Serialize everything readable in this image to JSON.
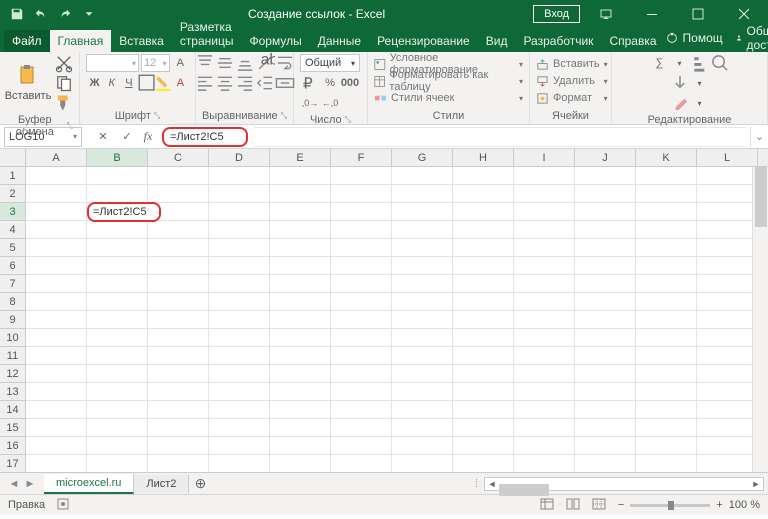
{
  "title": "Создание ссылок  -  Excel",
  "login": "Вход",
  "tabs": {
    "file": "Файл",
    "home": "Главная",
    "insert": "Вставка",
    "layout": "Разметка страницы",
    "formulas": "Формулы",
    "data": "Данные",
    "review": "Рецензирование",
    "view": "Вид",
    "developer": "Разработчик",
    "help": "Справка",
    "tellme": "Помощ",
    "share": "Общий доступ"
  },
  "ribbon": {
    "clipboard": {
      "label": "Буфер обмена",
      "paste": "Вставить"
    },
    "font": {
      "label": "Шрифт",
      "size": "12"
    },
    "align": {
      "label": "Выравнивание"
    },
    "number": {
      "label": "Число",
      "format": "Общий"
    },
    "styles": {
      "label": "Стили",
      "cond": "Условное форматирование",
      "table": "Форматировать как таблицу",
      "cell": "Стили ячеек"
    },
    "cells": {
      "label": "Ячейки",
      "insert": "Вставить",
      "delete": "Удалить",
      "format": "Формат"
    },
    "editing": {
      "label": "Редактирование"
    }
  },
  "namebox": "LOG10",
  "formula": "=Лист2!C5",
  "cell": {
    "value": "=Лист2!C5",
    "ref": "B3"
  },
  "cols": [
    "A",
    "B",
    "C",
    "D",
    "E",
    "F",
    "G",
    "H",
    "I",
    "J",
    "K",
    "L"
  ],
  "rows": [
    "1",
    "2",
    "3",
    "4",
    "5",
    "6",
    "7",
    "8",
    "9",
    "10",
    "11",
    "12",
    "13",
    "14",
    "15",
    "16",
    "17"
  ],
  "sheets": {
    "s1": "microexcel.ru",
    "s2": "Лист2"
  },
  "status": {
    "mode": "Правка",
    "zoom": "100 %"
  }
}
